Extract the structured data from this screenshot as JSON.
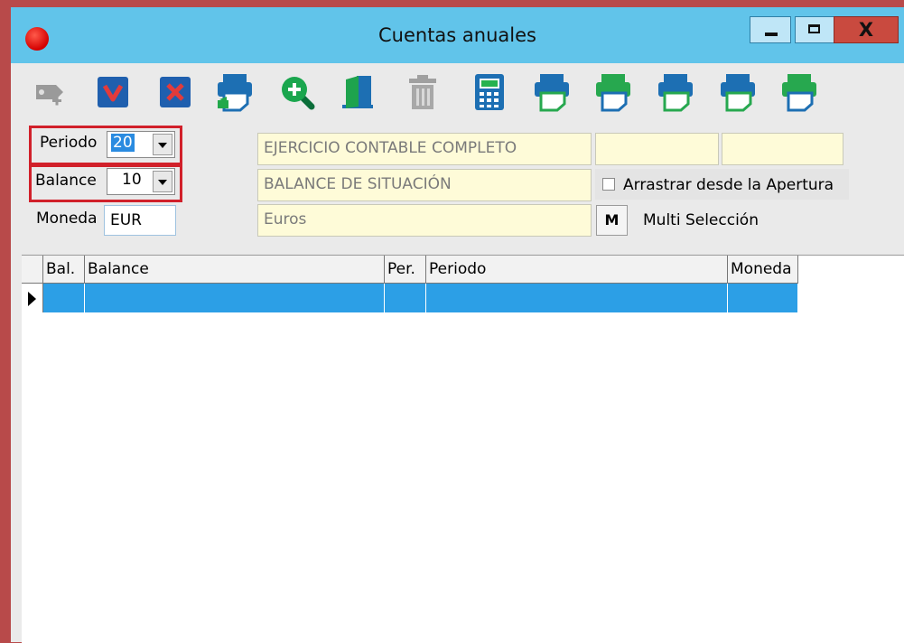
{
  "window": {
    "title": "Cuentas anuales",
    "close_label": "X"
  },
  "toolbar": {
    "icons": [
      "add-disabled-icon",
      "accept-icon",
      "cancel-icon",
      "print-icon",
      "search-icon",
      "exit-door-icon",
      "delete-disabled-icon",
      "calculator-icon",
      "print-blue-icon",
      "print-green-icon",
      "print-green-icon",
      "print-blue-green-icon",
      "print-green-icon"
    ]
  },
  "form": {
    "periodo_label": "Periodo",
    "periodo_value": "20",
    "balance_label": "Balance",
    "balance_value": "10",
    "moneda_label": "Moneda",
    "moneda_value": "EUR",
    "periodo_desc": "EJERCICIO CONTABLE COMPLETO",
    "balance_desc": "BALANCE DE SITUACIÓN",
    "moneda_desc": "Euros",
    "arrastrar_label": "Arrastrar desde la Apertura",
    "m_button": "M",
    "multi_label": "Multi Selección"
  },
  "grid": {
    "columns": [
      "Bal.",
      "Balance",
      "Per.",
      "Periodo",
      "Moneda"
    ]
  },
  "colors": {
    "titlebar": "#61c4ea",
    "selected_row": "#2c9fe6",
    "highlight_box": "#d1202a",
    "field_bg": "#fefbd8"
  }
}
